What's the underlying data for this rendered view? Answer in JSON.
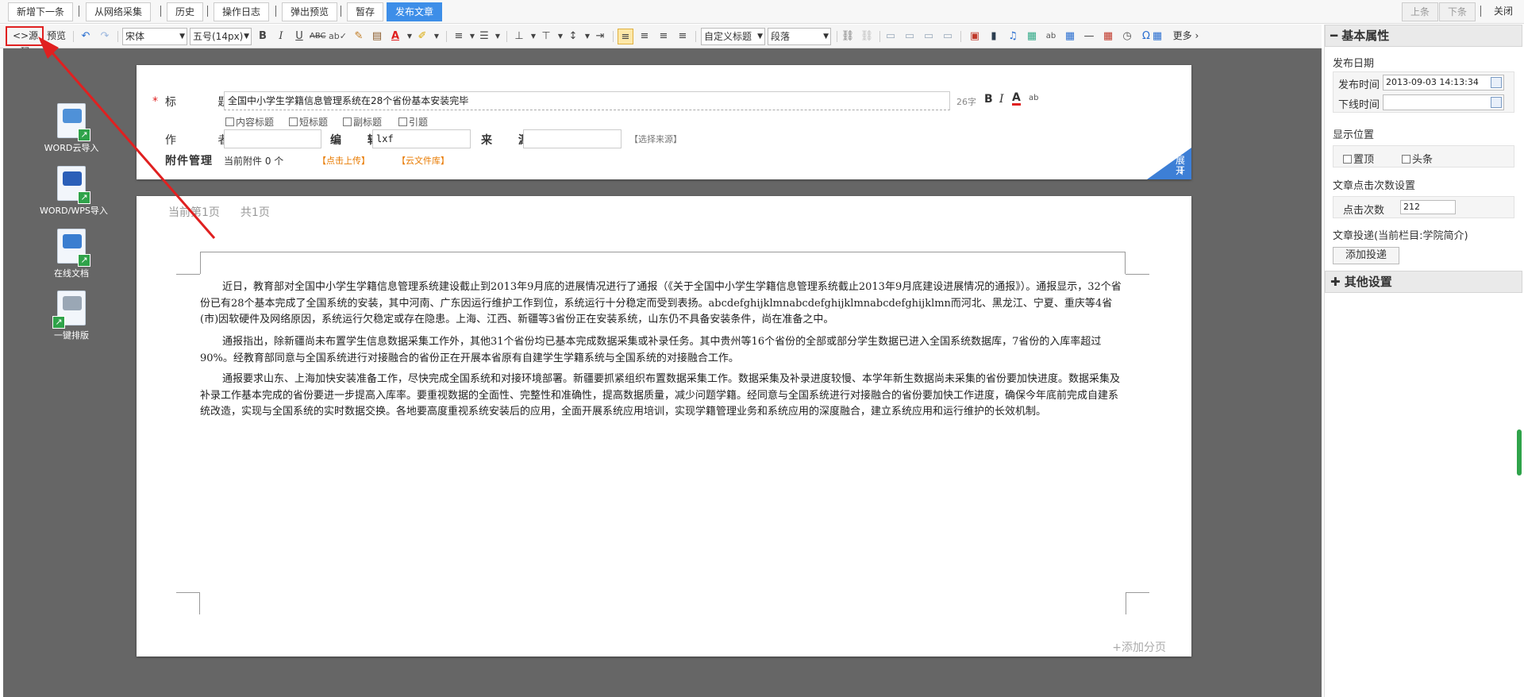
{
  "toolbar": {
    "buttons": [
      "新增下一条",
      "从网络采集",
      "历史",
      "操作日志",
      "弹出预览",
      "暂存",
      "发布文章"
    ],
    "right": [
      "上条",
      "下条",
      "关闭"
    ]
  },
  "editor_toolbar": {
    "source": "源码",
    "preview": "预览",
    "font_family": "宋体",
    "font_size": "五号(14px)",
    "heading": "自定义标题",
    "paragraph": "段落",
    "more": "更多"
  },
  "left_tools": [
    "WORD云导入",
    "WORD/WPS导入",
    "在线文档",
    "一键排版"
  ],
  "meta": {
    "title_label": "标 题",
    "title_value": "全国中小学生学籍信息管理系统在28个省份基本安装完毕",
    "title_count": "26字",
    "checkboxes": [
      "内容标题",
      "短标题",
      "副标题",
      "引题"
    ],
    "author_label": "作 者",
    "editor_label": "编 辑",
    "editor_value": "lxf",
    "source_label": "来 源",
    "choose_source": "【选择来源】",
    "attach_label": "附件管理",
    "attach_count": "当前附件 0 个",
    "upload": "【点击上传】",
    "cloud": "【云文件库】",
    "expand": "展开"
  },
  "page": {
    "current": "当前第1页",
    "total": "共1页",
    "paragraphs": [
      "近日，教育部对全国中小学生学籍信息管理系统建设截止到2013年9月底的进展情况进行了通报（《关于全国中小学生学籍信息管理系统截止2013年9月底建设进展情况的通报》）。通报显示，32个省份已有28个基本完成了全国系统的安装，其中河南、广东因运行维护工作到位，系统运行十分稳定而受到表扬。abcdefghijklmnabcdefghijklmnabcdefghijklmn而河北、黑龙江、宁夏、重庆等4省(市)因软硬件及网络原因，系统运行欠稳定或存在隐患。上海、江西、新疆等3省份正在安装系统，山东仍不具备安装条件，尚在准备之中。",
      "通报指出，除新疆尚未布置学生信息数据采集工作外，其他31个省份均已基本完成数据采集或补录任务。其中贵州等16个省份的全部或部分学生数据已进入全国系统数据库，7省份的入库率超过90%。经教育部同意与全国系统进行对接融合的省份正在开展本省原有自建学生学籍系统与全国系统的对接融合工作。",
      "通报要求山东、上海加快安装准备工作，尽快完成全国系统和对接环境部署。新疆要抓紧组织布置数据采集工作。数据采集及补录进度较慢、本学年新生数据尚未采集的省份要加快进度。数据采集及补录工作基本完成的省份要进一步提高入库率。要重视数据的全面性、完整性和准确性，提高数据质量，减少问题学籍。经同意与全国系统进行对接融合的省份要加快工作进度，确保今年底前完成自建系统改造，实现与全国系统的实时数据交换。各地要高度重视系统安装后的应用，全面开展系统应用培训，实现学籍管理业务和系统应用的深度融合，建立系统应用和运行维护的长效机制。"
    ],
    "add_page": "+添加分页"
  },
  "right_panel": {
    "basic": "基本属性",
    "pub_date": "发布日期",
    "pub_time_label": "发布时间",
    "pub_time_value": "2013-09-03 14:13:34",
    "offline_label": "下线时间",
    "display_pos": "显示位置",
    "top": "置顶",
    "headline": "头条",
    "click_settings": "文章点击次数设置",
    "clicks_label": "点击次数",
    "clicks_value": "212",
    "push": "文章投递(当前栏目:学院简介)",
    "add_push": "添加投递",
    "other": "其他设置"
  }
}
